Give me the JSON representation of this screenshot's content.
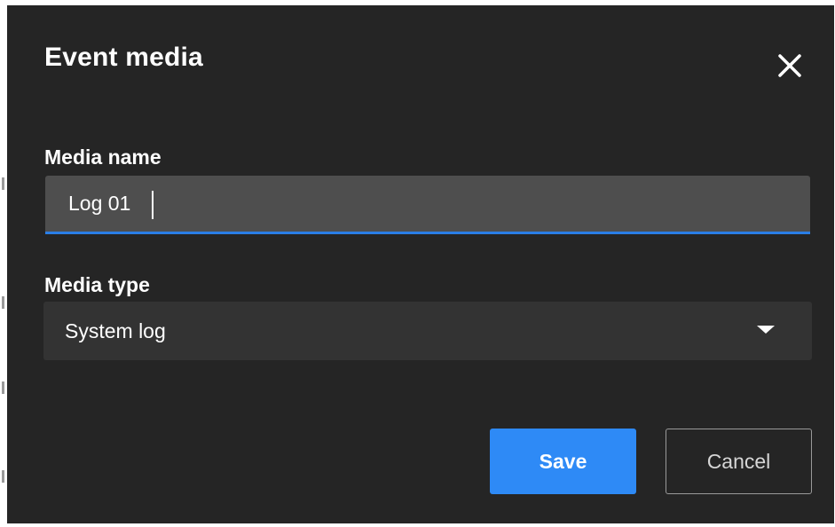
{
  "dialog": {
    "title": "Event media",
    "close_icon": "close-icon"
  },
  "fields": {
    "media_name": {
      "label": "Media name",
      "value": "Log 01"
    },
    "media_type": {
      "label": "Media type",
      "selected": "System log",
      "arrow_icon": "dropdown-arrow-icon"
    }
  },
  "actions": {
    "save_label": "Save",
    "cancel_label": "Cancel"
  },
  "colors": {
    "dialog_bg": "#252525",
    "input_bg": "#4e4e4e",
    "select_bg": "#333333",
    "accent": "#2e8af6",
    "focus_underline": "#2a7ee6"
  }
}
